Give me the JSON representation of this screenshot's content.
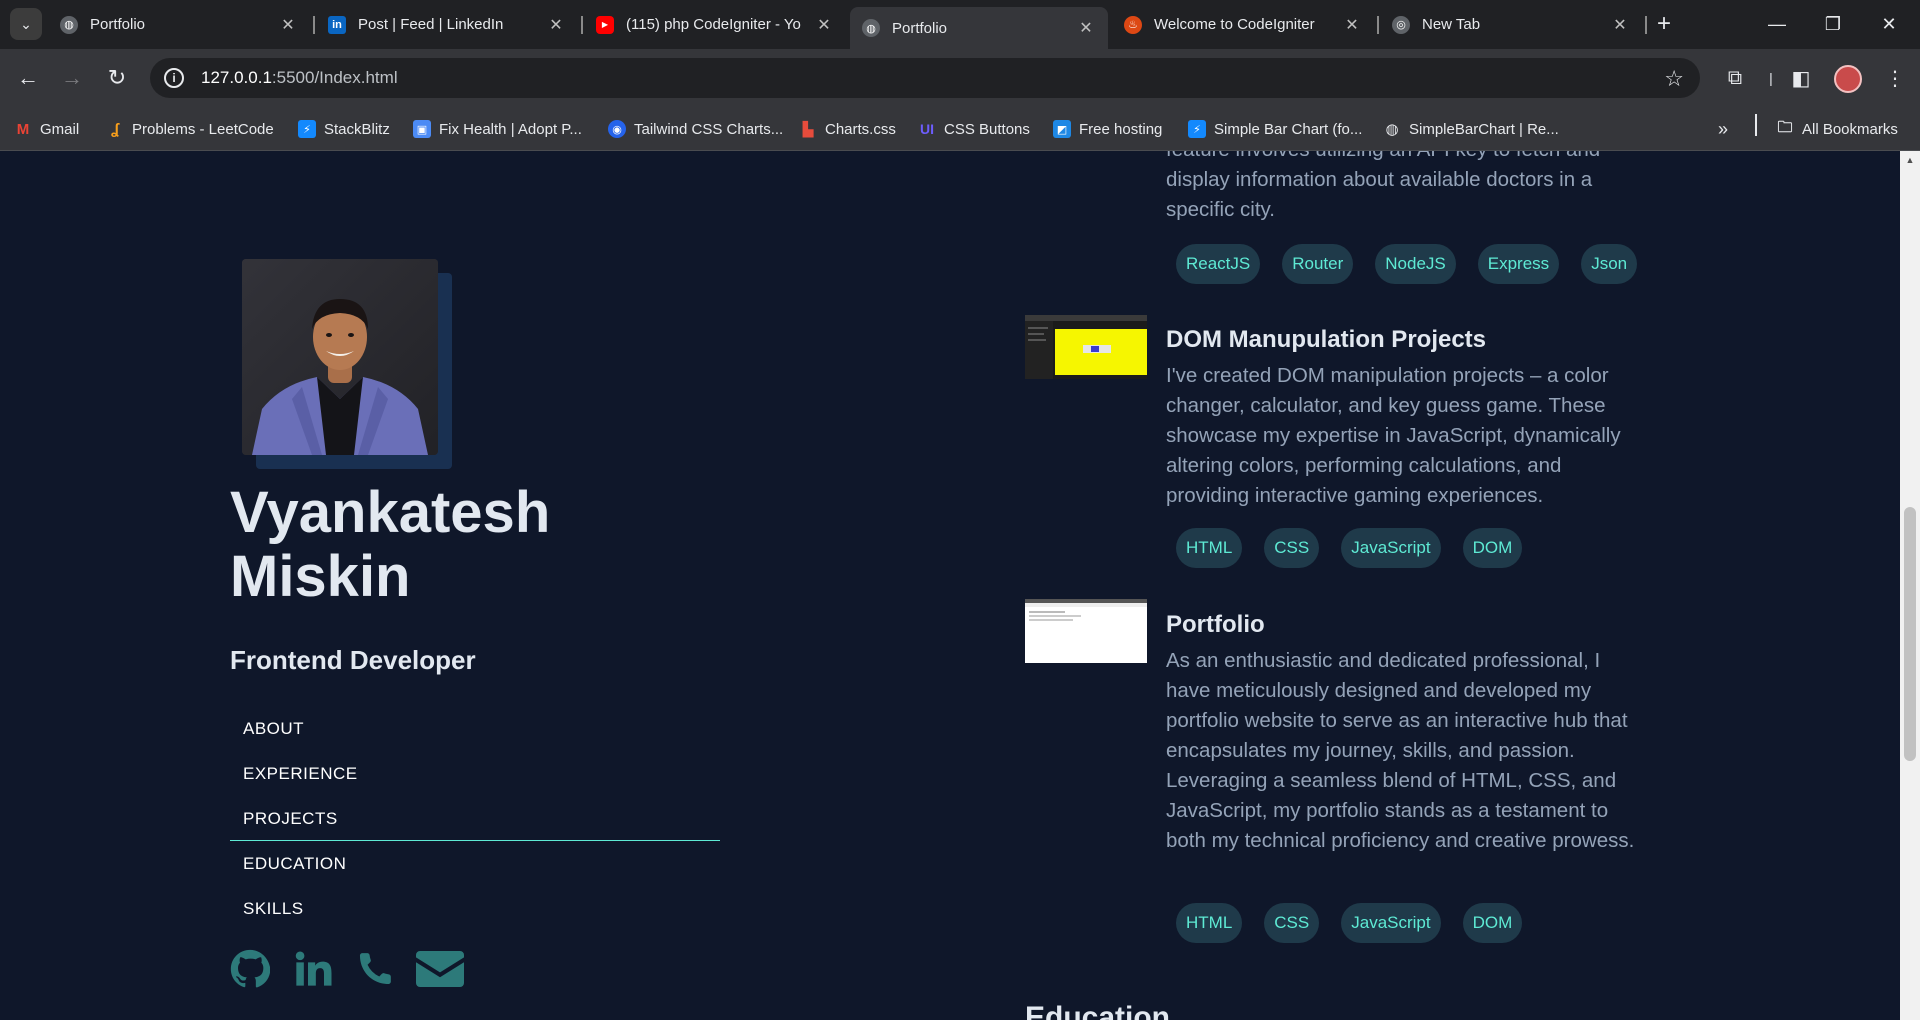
{
  "tabs": [
    {
      "title": "Portfolio",
      "favicon": "globe-icon"
    },
    {
      "title": "Post | Feed | LinkedIn",
      "favicon": "linkedin-icon"
    },
    {
      "title": "(115) php CodeIgniter - Yo",
      "favicon": "youtube-icon"
    },
    {
      "title": "Portfolio",
      "favicon": "globe-icon",
      "active": true
    },
    {
      "title": "Welcome to CodeIgniter",
      "favicon": "codeigniter-icon"
    },
    {
      "title": "New Tab",
      "favicon": "chrome-icon"
    }
  ],
  "address_bar": {
    "host": "127.0.0.1",
    "path": ":5500/Index.html"
  },
  "bookmarks": [
    {
      "label": "Gmail",
      "icon": "gmail-icon",
      "color": "#ea4335"
    },
    {
      "label": "Problems - LeetCode",
      "icon": "leetcode-icon",
      "color": "#f89f1b"
    },
    {
      "label": "StackBlitz",
      "icon": "stackblitz-icon",
      "color": "#1389fd"
    },
    {
      "label": "Fix Health | Adopt P...",
      "icon": "fixhealth-icon",
      "color": "#4c8bf5"
    },
    {
      "label": "Tailwind CSS Charts...",
      "icon": "tailwind-icon",
      "color": "#2563eb"
    },
    {
      "label": "Charts.css",
      "icon": "chartscss-icon",
      "color": "#e74c3c"
    },
    {
      "label": "CSS Buttons",
      "icon": "cssbuttons-icon",
      "color": "#6d5dfc"
    },
    {
      "label": "Free hosting",
      "icon": "freehosting-icon",
      "color": "#1e88e5"
    },
    {
      "label": "Simple Bar Chart (fo...",
      "icon": "stackblitz-icon",
      "color": "#1389fd"
    },
    {
      "label": "SimpleBarChart | Re...",
      "icon": "globe-icon",
      "color": "#e8eaed"
    }
  ],
  "all_bookmarks_label": "All Bookmarks",
  "profile": {
    "name_line1": "Vyankatesh",
    "name_line2": "Miskin",
    "role": "Frontend Developer"
  },
  "nav": [
    "ABOUT",
    "EXPERIENCE",
    "PROJECTS",
    "EDUCATION",
    "SKILLS"
  ],
  "nav_active": "PROJECTS",
  "socials": [
    "github-icon",
    "linkedin-icon",
    "phone-icon",
    "email-icon"
  ],
  "projects": [
    {
      "title": "",
      "description_lines": [
        "feature involves utilizing an API key to fetch and",
        "display information about available doctors in a",
        "specific city."
      ],
      "tags": [
        "ReactJS",
        "Router",
        "NodeJS",
        "Express",
        "Json"
      ]
    },
    {
      "title": "DOM Manupulation Projects",
      "description": "I've created DOM manipulation projects – a color changer, calculator, and key guess game. These showcase my expertise in JavaScript, dynamically altering colors, performing calculations, and providing interactive gaming experiences.",
      "tags": [
        "HTML",
        "CSS",
        "JavaScript",
        "DOM"
      ]
    },
    {
      "title": "Portfolio",
      "description": "As an enthusiastic and dedicated professional, I have meticulously designed and developed my portfolio website to serve as an interactive hub that encapsulates my journey, skills, and passion. Leveraging a seamless blend of HTML, CSS, and JavaScript, my portfolio stands as a testament to both my technical proficiency and creative prowess.",
      "tags": [
        "HTML",
        "CSS",
        "JavaScript",
        "DOM"
      ]
    }
  ],
  "next_section_heading": "Education",
  "theme": {
    "background": "#0f172a",
    "accent": "#5eead4",
    "text": "#e2e8f0",
    "muted": "#94a3b8"
  }
}
